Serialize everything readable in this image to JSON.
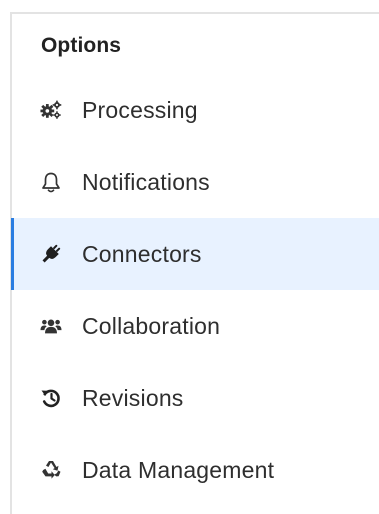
{
  "panel": {
    "heading": "Options"
  },
  "menu": {
    "active_index": 2,
    "items": [
      {
        "label": "Processing",
        "icon": "gears-icon"
      },
      {
        "label": "Notifications",
        "icon": "bell-icon"
      },
      {
        "label": "Connectors",
        "icon": "plug-icon"
      },
      {
        "label": "Collaboration",
        "icon": "users-icon"
      },
      {
        "label": "Revisions",
        "icon": "history-icon"
      },
      {
        "label": "Data Management",
        "icon": "recycle-icon"
      }
    ]
  },
  "colors": {
    "active_background": "#e8f2ff",
    "active_indicator": "#2a7de1",
    "text": "#2e2e2e"
  }
}
